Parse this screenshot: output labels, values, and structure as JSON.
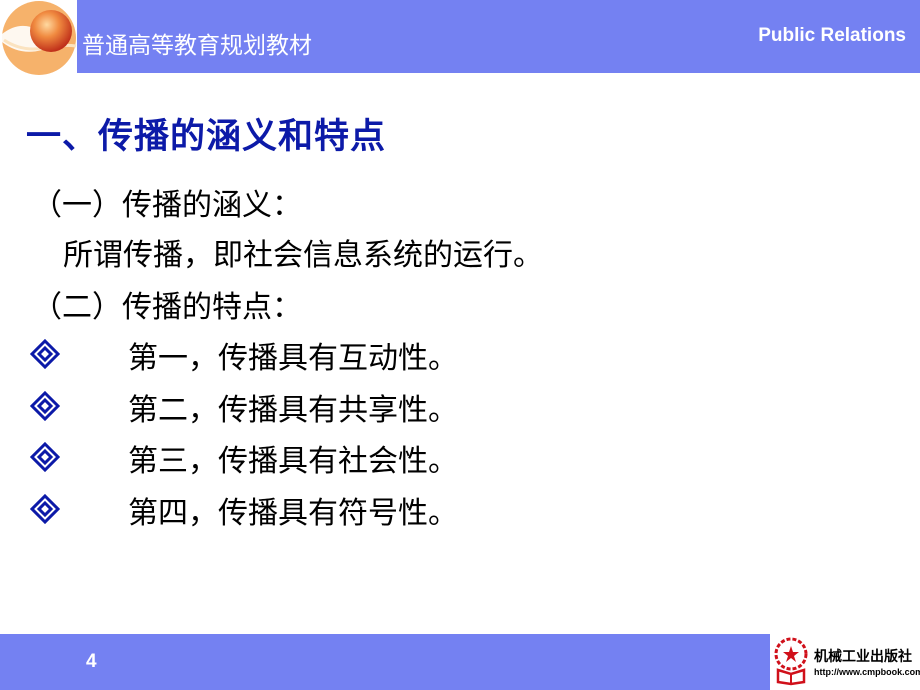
{
  "header": {
    "series_title": "普通高等教育规划教材",
    "course_title": "Public Relations",
    "logo_icon": "orange-sphere-logo-icon",
    "band_color": "#7481f2"
  },
  "slide": {
    "title": "一、传播的涵义和特点",
    "title_color": "#0c1aa8",
    "lines": [
      "（一）传播的涵义：",
      "所谓传播，即社会信息系统的运行。",
      "（二）传播的特点："
    ],
    "bullet_icon": "double-diamond-icon",
    "bullet_color": "#0c1aa8",
    "bullets": [
      "第一，传播具有互动性。",
      "第二，传播具有共享性。",
      "第三，传播具有社会性。",
      "第四，传播具有符号性。"
    ]
  },
  "footer": {
    "page_number": "4",
    "publisher_name": "机械工业出版社",
    "publisher_url": "http://www.cmpbook.com",
    "publisher_icon": "gear-star-book-emblem-icon"
  }
}
